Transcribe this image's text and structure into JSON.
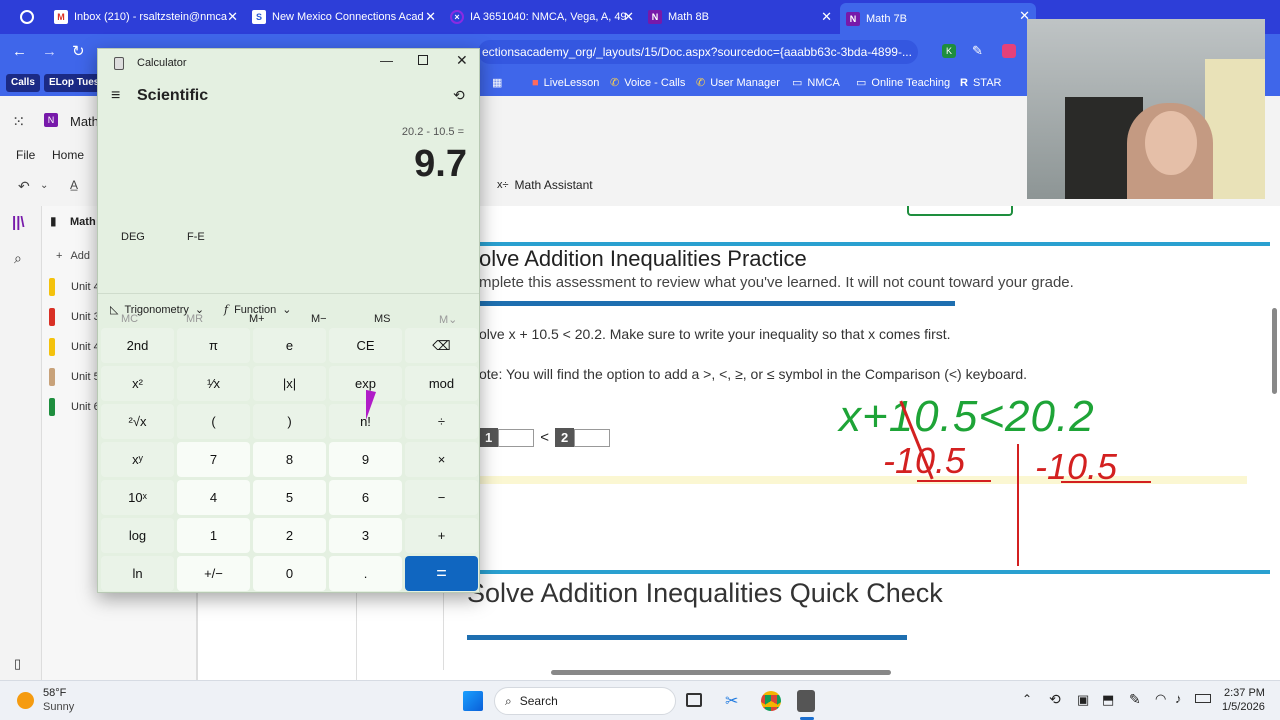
{
  "tabs": [
    {
      "label": "Inbox (210) - rsaltzstein@nmca",
      "icon": "gmail-icon",
      "color": "#d93025"
    },
    {
      "label": "New Mexico Connections Acad",
      "icon": "school-icon",
      "color": "#2a5cd6"
    },
    {
      "label": "IA 3651040: NMCA, Vega, A, 49",
      "icon": "circle-x-icon",
      "color": "#8a2be2"
    },
    {
      "label": "Math 8B",
      "icon": "onenote-icon",
      "color": "#7719aa"
    },
    {
      "label": "Math 7B",
      "icon": "onenote-icon",
      "color": "#7719aa"
    }
  ],
  "address": {
    "url": "ectionsacademy_org/_layouts/15/Doc.aspx?sourcedoc={aaabb63c-3bda-4899-..."
  },
  "bookmarks": [
    "Calls",
    "ELop Tues",
    "LiveLesson",
    "Voice - Calls",
    "User Manager",
    "NMCA",
    "Online Teaching",
    "STAR"
  ],
  "onenote": {
    "app_title": "Math",
    "menus": [
      "File",
      "Home"
    ],
    "notebook": "Math",
    "add_label": "Add",
    "units": [
      {
        "label": "Unit 4",
        "color": "#f4c20d"
      },
      {
        "label": "Unit 3",
        "color": "#d93025"
      },
      {
        "label": "Unit 4",
        "color": "#f4c20d"
      },
      {
        "label": "Unit 5",
        "color": "#c8a27a"
      },
      {
        "label": "Unit 6",
        "color": "#1e8e3e"
      }
    ],
    "math_assistant": "Math Assistant"
  },
  "page": {
    "heading1": "olve Addition Inequalities Practice",
    "subtitle": "mplete this assessment to review what you've learned. It will not count toward your grade.",
    "instruction": "olve x + 10.5 < 20.2. Make sure to write your inequality so that x comes first.",
    "note": "ote: You will find the option to add a >, <, ≥, or ≤ symbol in the Comparison (<) keyboard.",
    "answer_box1": "1",
    "answer_op": "<",
    "answer_box2": "2",
    "heading2": "Solve Addition Inequalities Quick Check",
    "handwriting": {
      "line1": "x+10.5<20.2",
      "line2a": "-10.5",
      "line2b": "-10.5"
    }
  },
  "calculator": {
    "title": "Calculator",
    "mode": "Scientific",
    "expression": "20.2 - 10.5 =",
    "result": "9.7",
    "angle": "DEG",
    "fe": "F-E",
    "memory": [
      "MC",
      "MR",
      "M+",
      "M−",
      "MS",
      "M⌄"
    ],
    "trig": "Trigonometry",
    "func": "Function",
    "keys": [
      [
        "2nd",
        "π",
        "e",
        "CE",
        "⌫"
      ],
      [
        "x²",
        "¹⁄x",
        "|x|",
        "exp",
        "mod"
      ],
      [
        "²√x",
        "(",
        ")",
        "n!",
        "÷"
      ],
      [
        "xʸ",
        "7",
        "8",
        "9",
        "×"
      ],
      [
        "10ˣ",
        "4",
        "5",
        "6",
        "−"
      ],
      [
        "log",
        "1",
        "2",
        "3",
        "+"
      ],
      [
        "ln",
        "+/−",
        "0",
        ".",
        "="
      ]
    ]
  },
  "taskbar": {
    "temp": "58°F",
    "weather": "Sunny",
    "search": "Search",
    "time": "2:37 PM",
    "date": "1/5/2026"
  }
}
